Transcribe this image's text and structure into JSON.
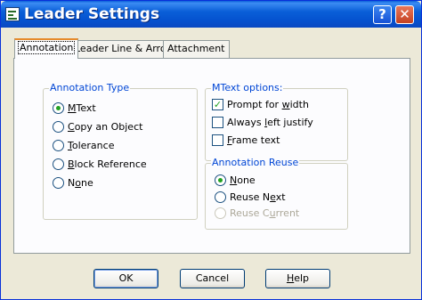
{
  "window": {
    "title": "Leader Settings",
    "help_button": "?",
    "close_button": "✕"
  },
  "tabs": [
    {
      "label": "Annotation",
      "active": true
    },
    {
      "label": "Leader Line & Arrow",
      "active": false
    },
    {
      "label": "Attachment",
      "active": false
    }
  ],
  "annotation_type": {
    "title": "Annotation Type",
    "options": [
      {
        "pre": "",
        "key": "M",
        "post": "Text",
        "checked": true
      },
      {
        "pre": "",
        "key": "C",
        "post": "opy an Object",
        "checked": false
      },
      {
        "pre": "",
        "key": "T",
        "post": "olerance",
        "checked": false
      },
      {
        "pre": "",
        "key": "B",
        "post": "lock Reference",
        "checked": false
      },
      {
        "pre": "N",
        "key": "o",
        "post": "ne",
        "checked": false
      }
    ]
  },
  "mtext_options": {
    "title": "MText options:",
    "options": [
      {
        "pre": "Prompt for ",
        "key": "w",
        "post": "idth",
        "checked": true
      },
      {
        "pre": "Always ",
        "key": "l",
        "post": "eft justify",
        "checked": false
      },
      {
        "pre": "",
        "key": "F",
        "post": "rame text",
        "checked": false
      }
    ]
  },
  "annotation_reuse": {
    "title": "Annotation Reuse",
    "options": [
      {
        "pre": "",
        "key": "N",
        "post": "one",
        "checked": true,
        "disabled": false
      },
      {
        "pre": "Reuse N",
        "key": "e",
        "post": "xt",
        "checked": false,
        "disabled": false
      },
      {
        "pre": "Reuse C",
        "key": "u",
        "post": "rrent",
        "checked": false,
        "disabled": true
      }
    ]
  },
  "buttons": {
    "ok": "OK",
    "cancel": "Cancel",
    "help_pre": "",
    "help_key": "H",
    "help_post": "elp"
  }
}
